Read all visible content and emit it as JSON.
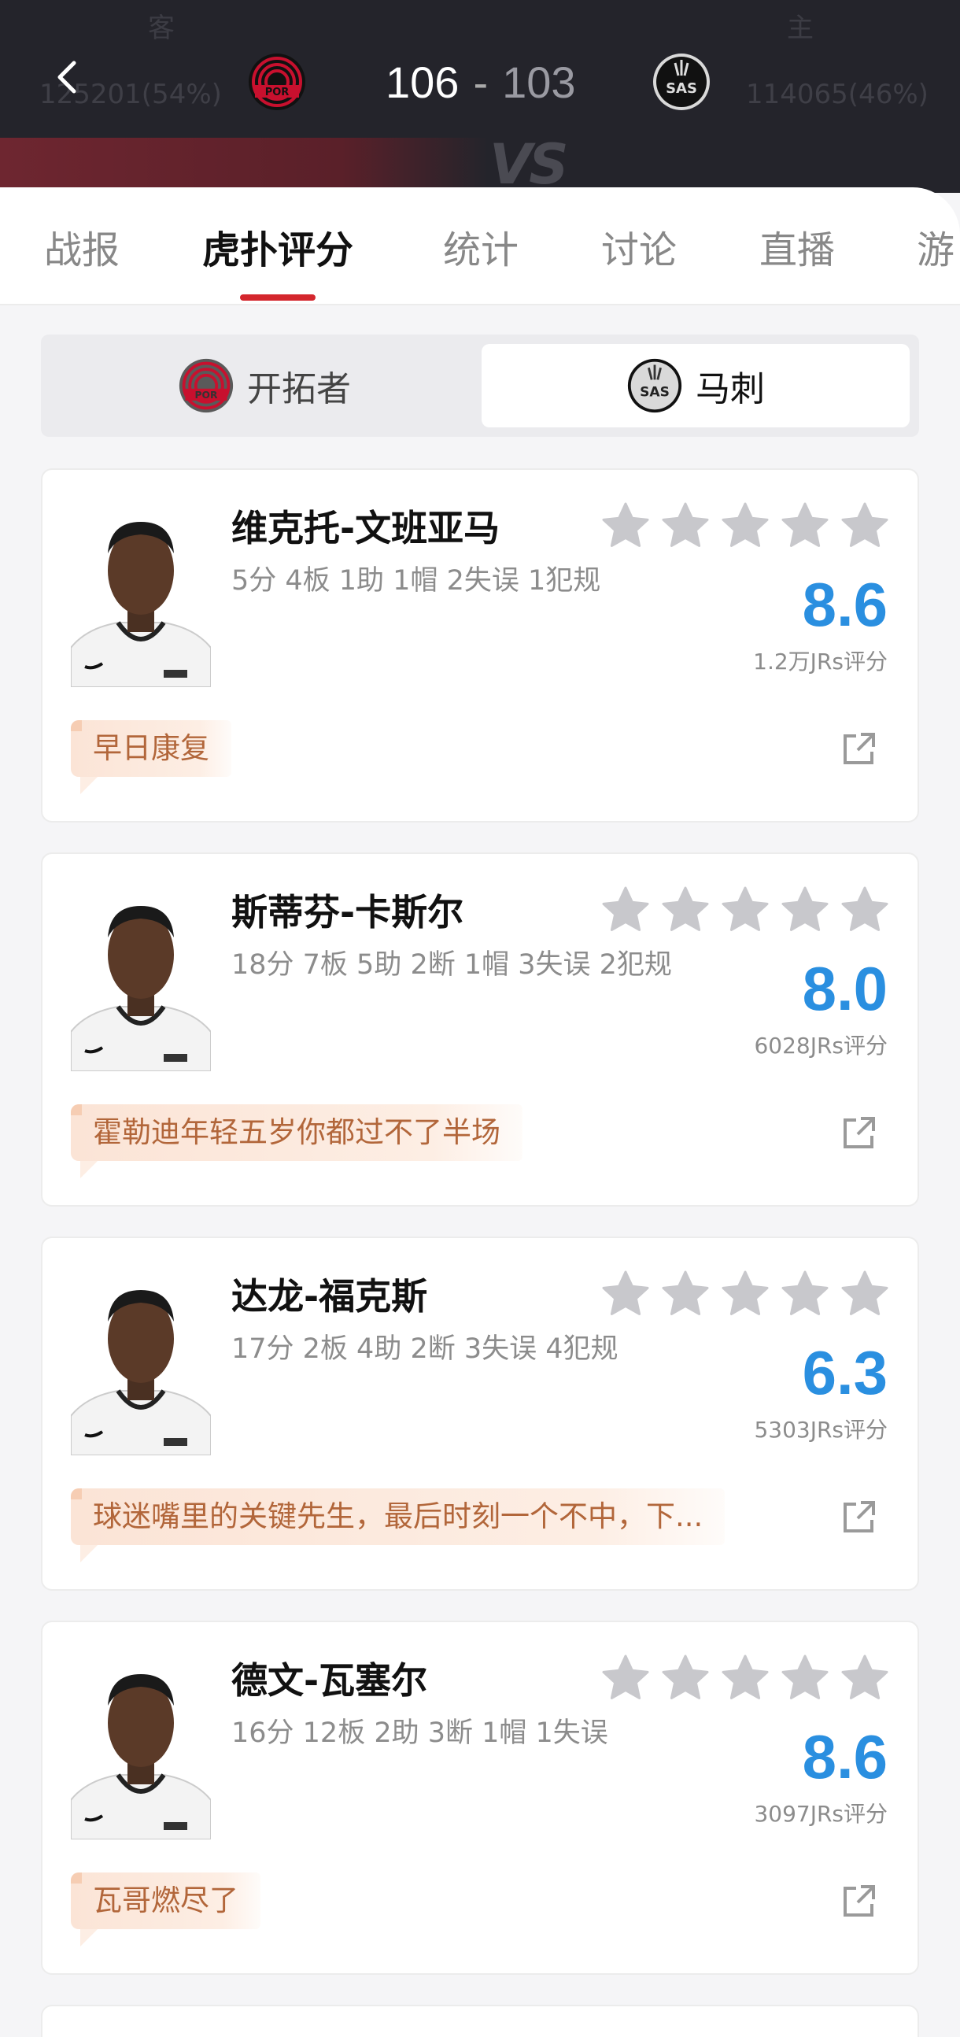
{
  "header": {
    "away_side_label": "客",
    "home_side_label": "主",
    "away_votes": "125201(54%)",
    "home_votes": "114065(46%)",
    "away_team_logo_text": "POR",
    "home_team_logo_text": "SAS",
    "score_home": "106",
    "score_separator": "-",
    "score_away": "103",
    "vs_text": "VS"
  },
  "tabs": [
    {
      "label": "战报"
    },
    {
      "label": "虎扑评分",
      "active": true
    },
    {
      "label": "统计"
    },
    {
      "label": "讨论"
    },
    {
      "label": "直播"
    },
    {
      "label": "游"
    }
  ],
  "team_switch": {
    "left": {
      "name": "开拓者",
      "logo_text": "POR"
    },
    "right": {
      "name": "马刺",
      "logo_text": "SAS",
      "selected": true
    }
  },
  "players": [
    {
      "name": "维克托-文班亚马",
      "stats": "5分 4板 1助 1帽 2失误 1犯规",
      "rating": "8.6",
      "rating_count": "1.2万JRs评分",
      "comment": "早日康复",
      "stars_filled": 0
    },
    {
      "name": "斯蒂芬-卡斯尔",
      "stats": "18分 7板 5助 2断 1帽 3失误 2犯规",
      "rating": "8.0",
      "rating_count": "6028JRs评分",
      "comment": "霍勒迪年轻五岁你都过不了半场",
      "stars_filled": 0
    },
    {
      "name": "达龙-福克斯",
      "stats": "17分 2板 4助 2断 3失误 4犯规",
      "rating": "6.3",
      "rating_count": "5303JRs评分",
      "comment": "球迷嘴里的关键先生，最后时刻一个不中，下...",
      "stars_filled": 0
    },
    {
      "name": "德文-瓦塞尔",
      "stats": "16分 12板 2助 3断 1帽 1失误",
      "rating": "8.6",
      "rating_count": "3097JRs评分",
      "comment": "瓦哥燃尽了",
      "stars_filled": 0
    }
  ],
  "colors": {
    "header_bg": "#24242b",
    "accent_red": "#d4262d",
    "rating_blue": "#2a8fe0",
    "comment_text": "#b2663a",
    "star_empty": "#c8c8cc"
  },
  "icons": [
    "back-arrow-icon",
    "por-logo-icon",
    "sas-logo-icon",
    "star-icon",
    "share-icon",
    "player-avatar-icon"
  ]
}
